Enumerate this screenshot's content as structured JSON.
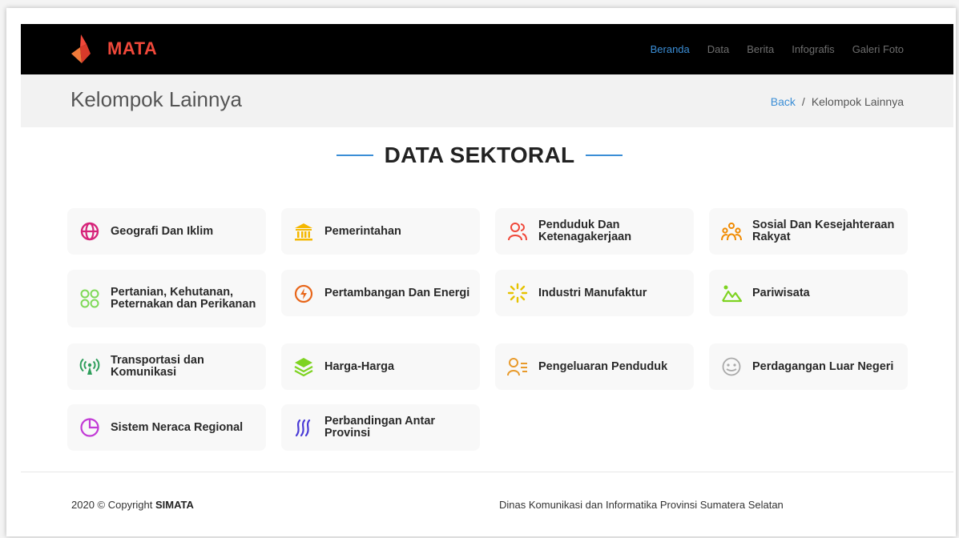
{
  "navbar": {
    "brand": "MATA",
    "links": [
      {
        "label": "Beranda",
        "active": true
      },
      {
        "label": "Data",
        "active": false
      },
      {
        "label": "Berita",
        "active": false
      },
      {
        "label": "Infografis",
        "active": false
      },
      {
        "label": "Galeri Foto",
        "active": false
      }
    ]
  },
  "title_bar": {
    "title": "Kelompok Lainnya",
    "breadcrumb": {
      "back": "Back",
      "separator": "/",
      "current": "Kelompok Lainnya"
    }
  },
  "section": {
    "heading": "DATA SEKTORAL",
    "accent_color": "#3b8ed6",
    "cards": [
      {
        "label": "Geografi Dan Iklim",
        "icon": "globe-icon",
        "color": "#d6247a"
      },
      {
        "label": "Pemerintahan",
        "icon": "government-building-icon",
        "color": "#f5b800"
      },
      {
        "label": "Penduduk Dan Ketenagakerjaan",
        "icon": "people-icon",
        "color": "#f0483a"
      },
      {
        "label": "Sosial Dan Kesejahteraan Rakyat",
        "icon": "community-icon",
        "color": "#f08a00"
      },
      {
        "label": "Pertanian, Kehutanan, Peternakan dan Perikanan",
        "icon": "grid-circles-icon",
        "color": "#7ed957"
      },
      {
        "label": "Pertambangan Dan Energi",
        "icon": "energy-drop-icon",
        "color": "#e8661a"
      },
      {
        "label": "Industri Manufaktur",
        "icon": "loader-icon",
        "color": "#e6c200"
      },
      {
        "label": "Pariwisata",
        "icon": "mountain-icon",
        "color": "#7ed321"
      },
      {
        "label": "Transportasi dan Komunikasi",
        "icon": "antenna-icon",
        "color": "#2e9e5b"
      },
      {
        "label": "Harga-Harga",
        "icon": "layers-icon",
        "color": "#7ed321"
      },
      {
        "label": "Pengeluaran Penduduk",
        "icon": "user-list-icon",
        "color": "#e89a2b"
      },
      {
        "label": "Perdagangan Luar Negeri",
        "icon": "trade-icon",
        "color": "#aaaaaa"
      },
      {
        "label": "Sistem Neraca Regional",
        "icon": "pie-chart-icon",
        "color": "#c23bd6"
      },
      {
        "label": "Perbandingan Antar Provinsi",
        "icon": "wave-lines-icon",
        "color": "#4a3bd6"
      }
    ]
  },
  "footer": {
    "copyright_prefix": "2020 © Copyright",
    "copyright_brand": "SIMATA",
    "organization": "Dinas Komunikasi dan Informatika Provinsi Sumatera Selatan"
  }
}
